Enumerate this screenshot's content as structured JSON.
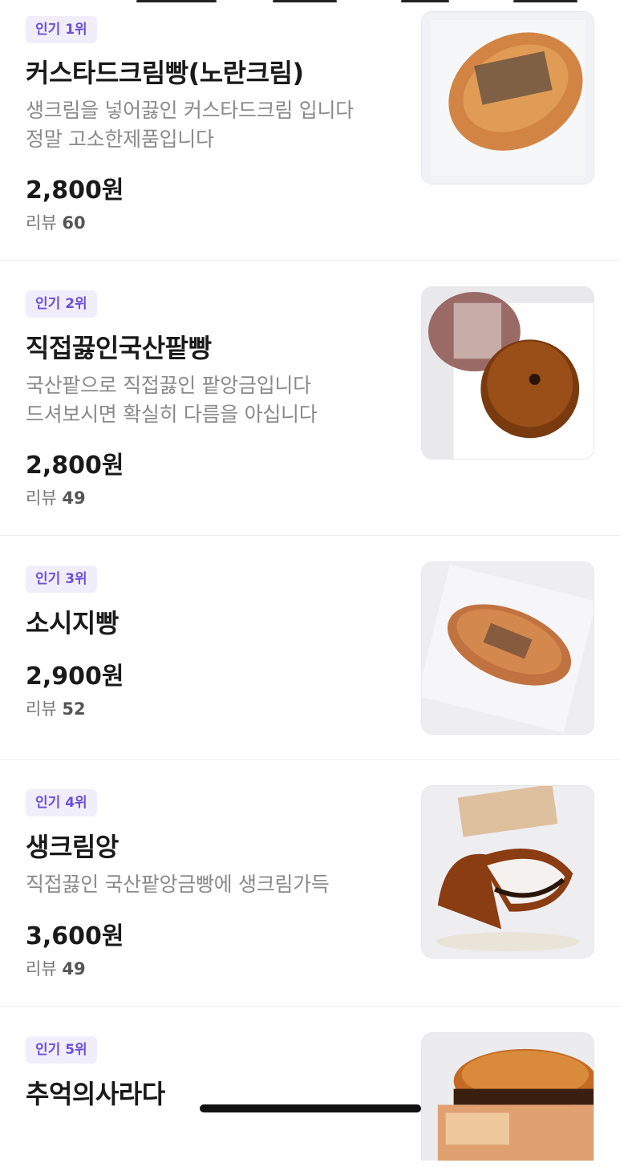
{
  "items": [
    {
      "badge": "인기 1위",
      "name": "커스타드크림빵(노란크림)",
      "desc": [
        "생크림을 넣어끓인 커스타드크림 입니다",
        "정말 고소한제품입니다"
      ],
      "price": "2,800원",
      "review_label": "리뷰",
      "review_count": "60"
    },
    {
      "badge": "인기 2위",
      "name": "직접끓인국산팥빵",
      "desc": [
        "국산팥으로 직접끓인 팥앙금입니다",
        "드셔보시면 확실히 다름을 아십니다"
      ],
      "price": "2,800원",
      "review_label": "리뷰",
      "review_count": "49"
    },
    {
      "badge": "인기 3위",
      "name": "소시지빵",
      "desc": [],
      "price": "2,900원",
      "review_label": "리뷰",
      "review_count": "52"
    },
    {
      "badge": "인기 4위",
      "name": "생크림앙",
      "desc": [
        "직접끓인 국산팥앙금빵에 생크림가득"
      ],
      "price": "3,600원",
      "review_label": "리뷰",
      "review_count": "49"
    },
    {
      "badge": "인기 5위",
      "name": "추억의사라다",
      "desc": [],
      "price": "",
      "review_label": "",
      "review_count": ""
    }
  ],
  "colors": {
    "badge_bg": "#f1eefc",
    "badge_text": "#6b4fd8",
    "desc_text": "#8a8a8a"
  }
}
